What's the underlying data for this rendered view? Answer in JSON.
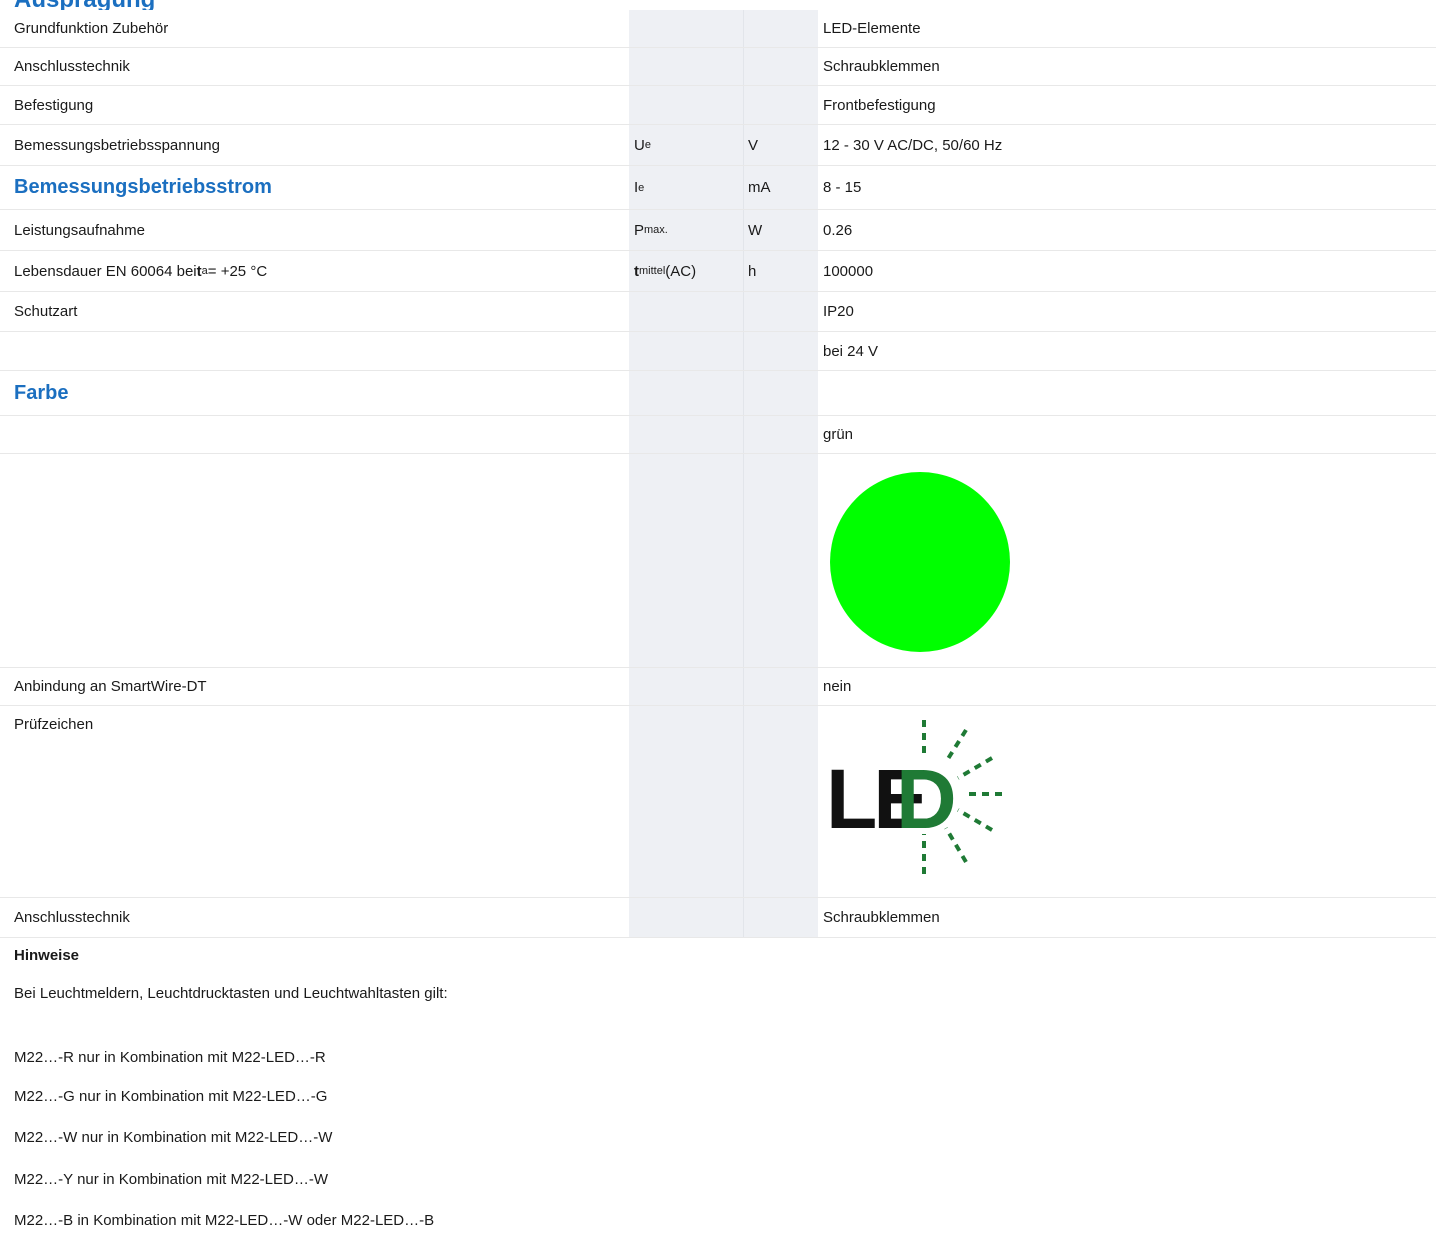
{
  "header": {
    "title": "Ausprägung"
  },
  "rows": {
    "r1": {
      "label": "Grundfunktion Zubehör",
      "value": "LED-Elemente"
    },
    "r2": {
      "label": "Anschlusstechnik",
      "value": "Schraubklemmen"
    },
    "r3": {
      "label": "Befestigung",
      "value": "Frontbefestigung"
    },
    "r4": {
      "label": "Bemessungsbetriebsspannung",
      "sym": "U",
      "sym_sub": "e",
      "unit": "V",
      "value": "12 - 30 V AC/DC, 50/60 Hz"
    },
    "r5": {
      "label": "Bemessungsbetriebsstrom",
      "sym": "I",
      "sym_sub": "e",
      "unit": "mA",
      "value": "8 - 15"
    },
    "r6": {
      "label": "Leistungsaufnahme",
      "sym": "P",
      "sym_sub": "max.",
      "unit": "W",
      "value": "0.26"
    },
    "r7": {
      "label_prefix": "Lebensdauer EN 60064 bei ",
      "label_sym": "t",
      "label_sub": "a",
      "label_suffix": " = +25 °C",
      "sym": "t",
      "sym_sub": "mittel",
      "sym_suffix": " (AC)",
      "unit": "h",
      "value": "100000"
    },
    "r8": {
      "label": "Schutzart",
      "value": "IP20"
    },
    "r9": {
      "value": "bei 24 V"
    },
    "r10": {
      "label": "Farbe"
    },
    "r11": {
      "value": "grün"
    },
    "r13": {
      "label": "Anbindung an SmartWire-DT",
      "value": "nein"
    },
    "r14": {
      "label": "Prüfzeichen"
    },
    "r15": {
      "label": "Anschlusstechnik",
      "value": "Schraubklemmen"
    }
  },
  "color_swatch": {
    "color": "#00ff00"
  },
  "led_logo": {
    "text_dark": "LE",
    "text_green": "D",
    "color_dark": "#111111",
    "color_green": "#1f7a35"
  },
  "notes": {
    "title": "Hinweise",
    "intro": "Bei Leuchtmeldern, Leuchtdrucktasten und Leuchtwahltasten gilt:",
    "items": [
      "M22…-R nur in Kombination mit M22-LED…-R",
      "M22…-G nur in Kombination mit M22-LED…-G",
      "M22…-W nur in Kombination mit M22-LED…-W",
      "M22…-Y nur in Kombination mit M22-LED…-W",
      "M22…-B in Kombination mit M22-LED…-W oder M22-LED…-B"
    ]
  }
}
